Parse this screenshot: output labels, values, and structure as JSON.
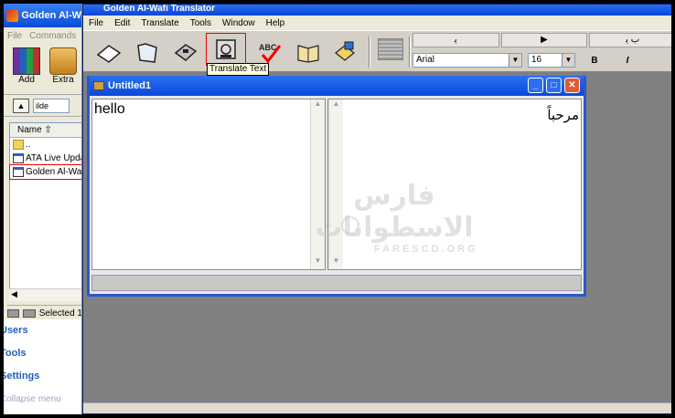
{
  "left_app": {
    "title": "Golden Al-W",
    "menu": [
      "File",
      "Commands"
    ],
    "toolbar": [
      {
        "label": "Add",
        "icon": "archive-books-icon"
      },
      {
        "label": "Extra",
        "icon": "extract-icon"
      }
    ],
    "path_text": "ilde",
    "column_header": "Name",
    "files": [
      {
        "name": "..",
        "icon": "folder-icon"
      },
      {
        "name": "ATA Live Upda",
        "icon": "app-window-icon"
      },
      {
        "name": "Golden Al-Wafi",
        "icon": "app-window-icon"
      }
    ],
    "status": "Selected 1",
    "tasks": [
      "Users",
      "Tools",
      "Settings",
      "Collapse menu"
    ]
  },
  "main_window": {
    "title": "Golden Al-Wafi Translator",
    "menu": [
      "File",
      "Edit",
      "Translate",
      "Tools",
      "Window",
      "Help"
    ],
    "toolbar_icons": [
      "eraser-icon",
      "open-folder-icon",
      "floppy-save-icon",
      "translate-text-icon",
      "spell-check-icon",
      "dictionary-book-icon",
      "speaker-hand-icon"
    ],
    "tooltip": "Translate Text",
    "format": {
      "row1": [
        "ﯾ",
        "▶",
        "ﺏ ﻳ"
      ],
      "font": "Arial",
      "size": "16",
      "bold": "B",
      "italic": "I"
    }
  },
  "document": {
    "title": "Untitled1",
    "source_text": "hello",
    "target_text": "مرحباً"
  },
  "watermark": {
    "arabic": "فارس الاسطوانات",
    "english": "FARESCD.ORG"
  }
}
